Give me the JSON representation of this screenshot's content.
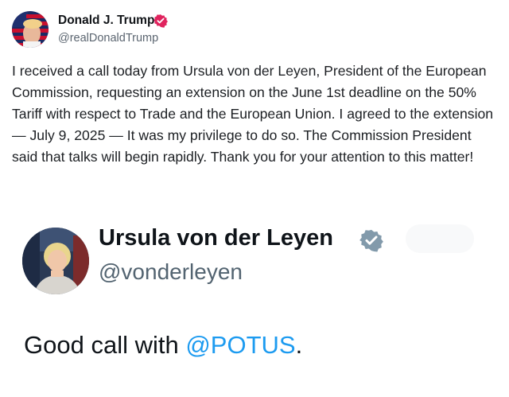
{
  "top_post": {
    "author_name": "Donald J. Trump",
    "handle": "@realDonaldTrump",
    "verified_badge_icon": "verified-badge-icon",
    "text": "I received a call today from Ursula von der Leyen, President of the European Commission, requesting an extension on the June 1st deadline on the 50% Tariff with respect to Trade and the European Union. I agreed to the extension — July 9, 2025 — It was my privilege to do so. The Commission President said that talks will begin rapidly. Thank you for your attention to this matter!"
  },
  "embedded_post": {
    "author_name": "Ursula von der Leyen",
    "handle": "@vonderleyen",
    "verified_badge_icon": "verified-badge-icon",
    "text_before": "Good call with ",
    "mention": "@POTUS",
    "text_after": "."
  },
  "colors": {
    "badge_top": "#e0245e",
    "badge_embed": "#829aab",
    "mention": "#1d9bf0",
    "handle": "#5b6570"
  }
}
